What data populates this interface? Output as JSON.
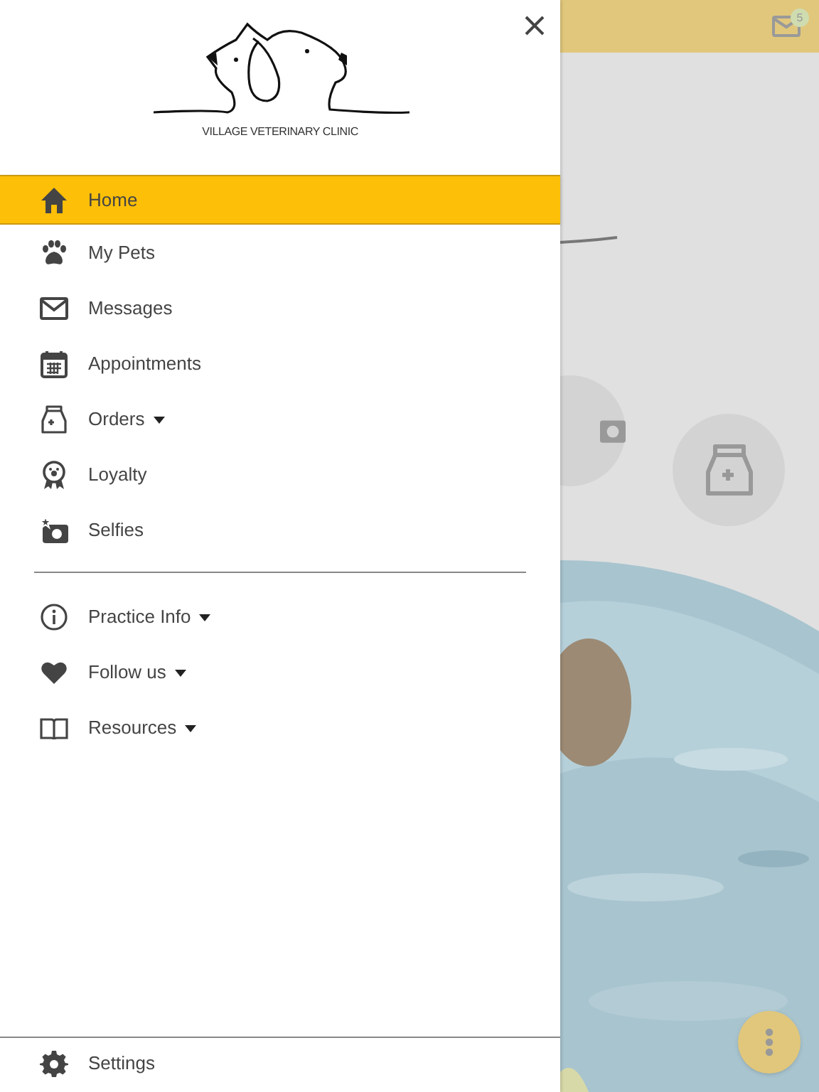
{
  "drawer": {
    "logo_text": "VILLAGE VETERINARY CLINIC",
    "items": [
      {
        "label": "Home",
        "kind": "home",
        "selected": true,
        "dropdown": false
      },
      {
        "label": "My Pets",
        "kind": "paw",
        "selected": false,
        "dropdown": false
      },
      {
        "label": "Messages",
        "kind": "mail",
        "selected": false,
        "dropdown": false
      },
      {
        "label": "Appointments",
        "kind": "calendar",
        "selected": false,
        "dropdown": false
      },
      {
        "label": "Orders",
        "kind": "bag",
        "selected": false,
        "dropdown": true
      },
      {
        "label": "Loyalty",
        "kind": "ribbon",
        "selected": false,
        "dropdown": false
      },
      {
        "label": "Selfies",
        "kind": "camera",
        "selected": false,
        "dropdown": false
      }
    ],
    "secondary_items": [
      {
        "label": "Practice Info",
        "kind": "info",
        "selected": false,
        "dropdown": true
      },
      {
        "label": "Follow us",
        "kind": "heart",
        "selected": false,
        "dropdown": true
      },
      {
        "label": "Resources",
        "kind": "book",
        "selected": false,
        "dropdown": true
      }
    ],
    "footer_item": {
      "label": "Settings",
      "kind": "gear"
    }
  },
  "background": {
    "message_badge": "5"
  }
}
